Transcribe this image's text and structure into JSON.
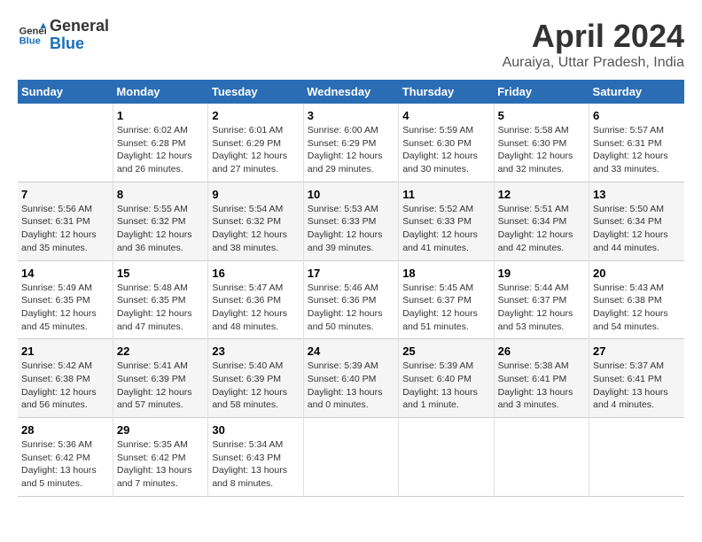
{
  "header": {
    "logo_line1": "General",
    "logo_line2": "Blue",
    "title": "April 2024",
    "subtitle": "Auraiya, Uttar Pradesh, India"
  },
  "columns": [
    "Sunday",
    "Monday",
    "Tuesday",
    "Wednesday",
    "Thursday",
    "Friday",
    "Saturday"
  ],
  "weeks": [
    [
      {
        "day": "",
        "info": ""
      },
      {
        "day": "1",
        "info": "Sunrise: 6:02 AM\nSunset: 6:28 PM\nDaylight: 12 hours\nand 26 minutes."
      },
      {
        "day": "2",
        "info": "Sunrise: 6:01 AM\nSunset: 6:29 PM\nDaylight: 12 hours\nand 27 minutes."
      },
      {
        "day": "3",
        "info": "Sunrise: 6:00 AM\nSunset: 6:29 PM\nDaylight: 12 hours\nand 29 minutes."
      },
      {
        "day": "4",
        "info": "Sunrise: 5:59 AM\nSunset: 6:30 PM\nDaylight: 12 hours\nand 30 minutes."
      },
      {
        "day": "5",
        "info": "Sunrise: 5:58 AM\nSunset: 6:30 PM\nDaylight: 12 hours\nand 32 minutes."
      },
      {
        "day": "6",
        "info": "Sunrise: 5:57 AM\nSunset: 6:31 PM\nDaylight: 12 hours\nand 33 minutes."
      }
    ],
    [
      {
        "day": "7",
        "info": "Sunrise: 5:56 AM\nSunset: 6:31 PM\nDaylight: 12 hours\nand 35 minutes."
      },
      {
        "day": "8",
        "info": "Sunrise: 5:55 AM\nSunset: 6:32 PM\nDaylight: 12 hours\nand 36 minutes."
      },
      {
        "day": "9",
        "info": "Sunrise: 5:54 AM\nSunset: 6:32 PM\nDaylight: 12 hours\nand 38 minutes."
      },
      {
        "day": "10",
        "info": "Sunrise: 5:53 AM\nSunset: 6:33 PM\nDaylight: 12 hours\nand 39 minutes."
      },
      {
        "day": "11",
        "info": "Sunrise: 5:52 AM\nSunset: 6:33 PM\nDaylight: 12 hours\nand 41 minutes."
      },
      {
        "day": "12",
        "info": "Sunrise: 5:51 AM\nSunset: 6:34 PM\nDaylight: 12 hours\nand 42 minutes."
      },
      {
        "day": "13",
        "info": "Sunrise: 5:50 AM\nSunset: 6:34 PM\nDaylight: 12 hours\nand 44 minutes."
      }
    ],
    [
      {
        "day": "14",
        "info": "Sunrise: 5:49 AM\nSunset: 6:35 PM\nDaylight: 12 hours\nand 45 minutes."
      },
      {
        "day": "15",
        "info": "Sunrise: 5:48 AM\nSunset: 6:35 PM\nDaylight: 12 hours\nand 47 minutes."
      },
      {
        "day": "16",
        "info": "Sunrise: 5:47 AM\nSunset: 6:36 PM\nDaylight: 12 hours\nand 48 minutes."
      },
      {
        "day": "17",
        "info": "Sunrise: 5:46 AM\nSunset: 6:36 PM\nDaylight: 12 hours\nand 50 minutes."
      },
      {
        "day": "18",
        "info": "Sunrise: 5:45 AM\nSunset: 6:37 PM\nDaylight: 12 hours\nand 51 minutes."
      },
      {
        "day": "19",
        "info": "Sunrise: 5:44 AM\nSunset: 6:37 PM\nDaylight: 12 hours\nand 53 minutes."
      },
      {
        "day": "20",
        "info": "Sunrise: 5:43 AM\nSunset: 6:38 PM\nDaylight: 12 hours\nand 54 minutes."
      }
    ],
    [
      {
        "day": "21",
        "info": "Sunrise: 5:42 AM\nSunset: 6:38 PM\nDaylight: 12 hours\nand 56 minutes."
      },
      {
        "day": "22",
        "info": "Sunrise: 5:41 AM\nSunset: 6:39 PM\nDaylight: 12 hours\nand 57 minutes."
      },
      {
        "day": "23",
        "info": "Sunrise: 5:40 AM\nSunset: 6:39 PM\nDaylight: 12 hours\nand 58 minutes."
      },
      {
        "day": "24",
        "info": "Sunrise: 5:39 AM\nSunset: 6:40 PM\nDaylight: 13 hours\nand 0 minutes."
      },
      {
        "day": "25",
        "info": "Sunrise: 5:39 AM\nSunset: 6:40 PM\nDaylight: 13 hours\nand 1 minute."
      },
      {
        "day": "26",
        "info": "Sunrise: 5:38 AM\nSunset: 6:41 PM\nDaylight: 13 hours\nand 3 minutes."
      },
      {
        "day": "27",
        "info": "Sunrise: 5:37 AM\nSunset: 6:41 PM\nDaylight: 13 hours\nand 4 minutes."
      }
    ],
    [
      {
        "day": "28",
        "info": "Sunrise: 5:36 AM\nSunset: 6:42 PM\nDaylight: 13 hours\nand 5 minutes."
      },
      {
        "day": "29",
        "info": "Sunrise: 5:35 AM\nSunset: 6:42 PM\nDaylight: 13 hours\nand 7 minutes."
      },
      {
        "day": "30",
        "info": "Sunrise: 5:34 AM\nSunset: 6:43 PM\nDaylight: 13 hours\nand 8 minutes."
      },
      {
        "day": "",
        "info": ""
      },
      {
        "day": "",
        "info": ""
      },
      {
        "day": "",
        "info": ""
      },
      {
        "day": "",
        "info": ""
      }
    ]
  ]
}
